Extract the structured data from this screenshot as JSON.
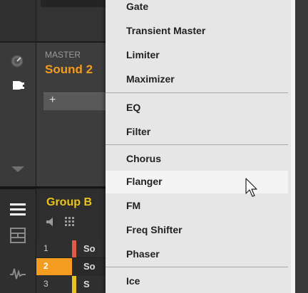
{
  "left_panel": {
    "master_label": "MASTER",
    "sound_label": "Sound 2",
    "add_plugin": "+",
    "group_label": "Group B",
    "rows": [
      {
        "num": "1",
        "text": "So",
        "stripe": "#e05a4a"
      },
      {
        "num": "2",
        "text": "So",
        "stripe": "#f39c1f"
      },
      {
        "num": "3",
        "text": "S",
        "stripe": "#e8c41c"
      }
    ]
  },
  "menu": {
    "items": [
      {
        "label": "Gate"
      },
      {
        "label": "Transient Master"
      },
      {
        "label": "Limiter"
      },
      {
        "label": "Maximizer"
      },
      {
        "label": "EQ"
      },
      {
        "label": "Filter"
      },
      {
        "label": "Chorus"
      },
      {
        "label": "Flanger"
      },
      {
        "label": "FM"
      },
      {
        "label": "Freq Shifter"
      },
      {
        "label": "Phaser"
      },
      {
        "label": "Ice"
      }
    ],
    "highlighted": "Flanger"
  },
  "colors": {
    "accent_orange": "#f39c1f",
    "accent_yellow": "#e8c41c",
    "menu_bg": "#e6e6e6",
    "menu_highlight": "#f4f4f4"
  }
}
